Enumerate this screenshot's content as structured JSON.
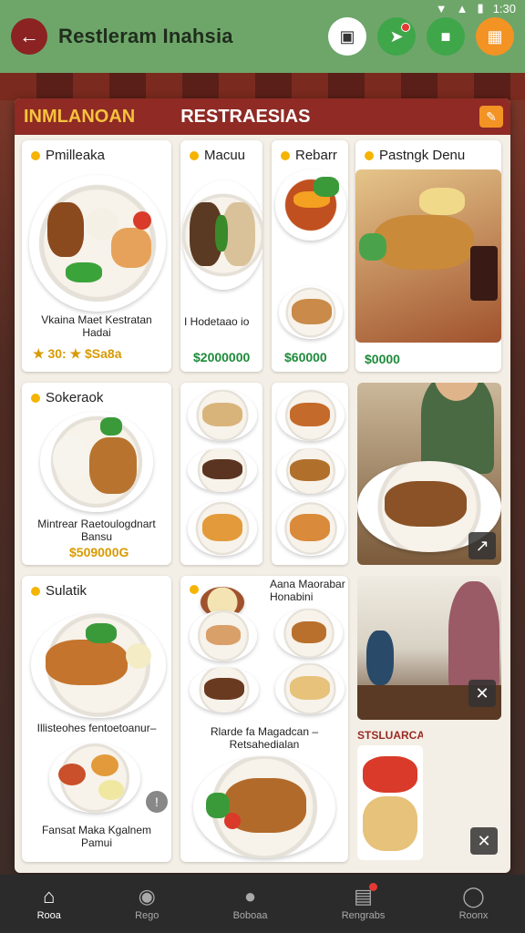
{
  "status": {
    "time": "1:30"
  },
  "app_bar": {
    "title": "Restleram Inahsia",
    "icons": [
      "back-arrow-icon",
      "camera-icon",
      "map-pin-icon",
      "box-icon",
      "grid-icon"
    ],
    "colors": {
      "bar": "#6ea66a",
      "back": "#8b2323",
      "accent": "#f39324"
    }
  },
  "panel": {
    "left_title": "INMLANOAN",
    "right_title": "RESTRAESIAS"
  },
  "cards": {
    "c1": {
      "title": "Pmilleaka",
      "desc": "Vkaina Maet Kestratan Hadai",
      "price": "★ 30: ★ $Sa8a"
    },
    "c2": {
      "title": "Macuu",
      "desc": "I Hodetaao io",
      "price": "$2000000"
    },
    "c3": {
      "title": "Rebarr",
      "price": "$60000"
    },
    "c4": {
      "title": "Pastngk Denu",
      "price": "$0000"
    },
    "c5": {
      "title": "Sokeraok",
      "desc": "Mintrear Raetoulogdnart Bansu",
      "price": "$509000G"
    },
    "c6": {
      "title": "Sulatik",
      "desc": "Illisteohes fentoetoanur–"
    },
    "c6b": {
      "desc": "Fansat Maka Kgalnem Pamui"
    },
    "c7": {
      "title": "Aana Maorabar Honabini",
      "desc": "Rlarde fa Magadcan – Retsahedialan"
    },
    "c8": {
      "title": "STSLUARCAN"
    }
  },
  "bottom_nav": {
    "items": [
      {
        "label": "Rooa",
        "icon": "home-icon",
        "active": true
      },
      {
        "label": "Rego",
        "icon": "pig-icon"
      },
      {
        "label": "Boboaa",
        "icon": "globe-icon"
      },
      {
        "label": "Rengrabs",
        "icon": "printer-icon"
      },
      {
        "label": "Roonx",
        "icon": "person-icon"
      }
    ]
  }
}
